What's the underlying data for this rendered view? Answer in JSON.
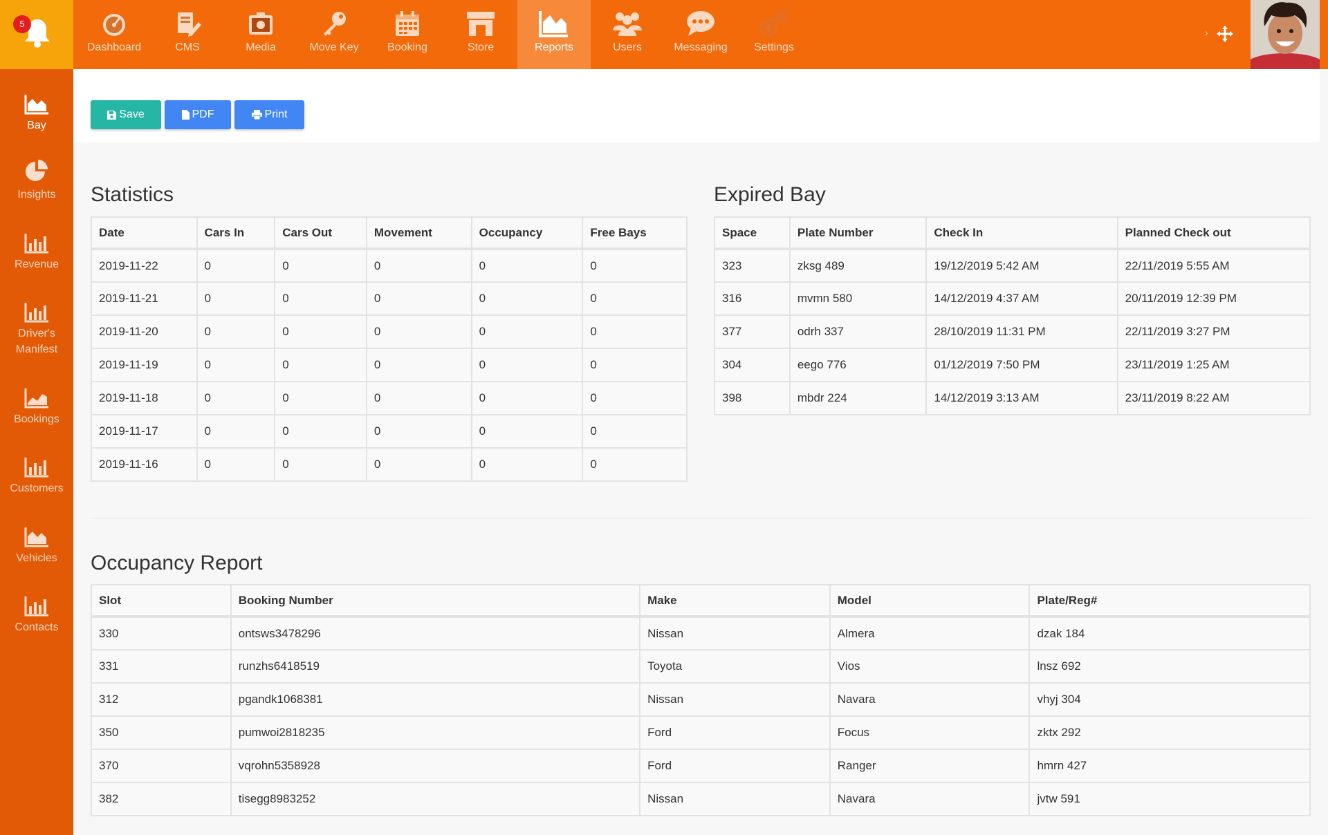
{
  "notifications": {
    "count": "5"
  },
  "topnav": [
    {
      "label": "Dashboard",
      "icon": "dashboard-gauge-icon"
    },
    {
      "label": "CMS",
      "icon": "cms-document-edit-icon"
    },
    {
      "label": "Media",
      "icon": "media-camera-icon"
    },
    {
      "label": "Move Key",
      "icon": "key-icon"
    },
    {
      "label": "Booking",
      "icon": "calendar-icon"
    },
    {
      "label": "Store",
      "icon": "store-icon"
    },
    {
      "label": "Reports",
      "icon": "area-chart-icon",
      "active": true
    },
    {
      "label": "Users",
      "icon": "users-icon"
    },
    {
      "label": "Messaging",
      "icon": "chat-bubble-icon"
    },
    {
      "label": "Settings",
      "icon": "gears-icon"
    }
  ],
  "sidebar": [
    {
      "label": "Bay",
      "icon": "area-chart-icon",
      "active": true
    },
    {
      "label": "Insights",
      "icon": "pie-chart-icon"
    },
    {
      "label": "Revenue",
      "icon": "bar-chart-icon"
    },
    {
      "label": "Driver's Manifest",
      "icon": "bar-chart-icon"
    },
    {
      "label": "Bookings",
      "icon": "line-chart-icon"
    },
    {
      "label": "Customers",
      "icon": "bar-chart-icon"
    },
    {
      "label": "Vehicles",
      "icon": "area-chart-icon"
    },
    {
      "label": "Contacts",
      "icon": "bar-chart-icon"
    }
  ],
  "actions": {
    "save": "Save",
    "pdf": "PDF",
    "print": "Print"
  },
  "colors": {
    "topbar": "#f26a0a",
    "sidebar": "#e25a06",
    "bell_box": "#f7a30a",
    "save": "#26b6a6",
    "pdf_print": "#4286f4"
  },
  "statistics": {
    "title": "Statistics",
    "headers": [
      "Date",
      "Cars In",
      "Cars Out",
      "Movement",
      "Occupancy",
      "Free Bays"
    ],
    "rows": [
      [
        "2019-11-22",
        "0",
        "0",
        "0",
        "0",
        "0"
      ],
      [
        "2019-11-21",
        "0",
        "0",
        "0",
        "0",
        "0"
      ],
      [
        "2019-11-20",
        "0",
        "0",
        "0",
        "0",
        "0"
      ],
      [
        "2019-11-19",
        "0",
        "0",
        "0",
        "0",
        "0"
      ],
      [
        "2019-11-18",
        "0",
        "0",
        "0",
        "0",
        "0"
      ],
      [
        "2019-11-17",
        "0",
        "0",
        "0",
        "0",
        "0"
      ],
      [
        "2019-11-16",
        "0",
        "0",
        "0",
        "0",
        "0"
      ]
    ]
  },
  "expired_bay": {
    "title": "Expired Bay",
    "headers": [
      "Space",
      "Plate Number",
      "Check In",
      "Planned Check out"
    ],
    "rows": [
      [
        "323",
        "zksg 489",
        "19/12/2019 5:42 AM",
        "22/11/2019 5:55 AM"
      ],
      [
        "316",
        "mvmn 580",
        "14/12/2019 4:37 AM",
        "20/11/2019 12:39 PM"
      ],
      [
        "377",
        "odrh 337",
        "28/10/2019 11:31 PM",
        "22/11/2019 3:27 PM"
      ],
      [
        "304",
        "eego 776",
        "01/12/2019 7:50 PM",
        "23/11/2019 1:25 AM"
      ],
      [
        "398",
        "mbdr 224",
        "14/12/2019 3:13 AM",
        "23/11/2019 8:22 AM"
      ]
    ]
  },
  "occupancy": {
    "title": "Occupancy Report",
    "headers": [
      "Slot",
      "Booking Number",
      "Make",
      "Model",
      "Plate/Reg#"
    ],
    "rows": [
      [
        "330",
        "ontsws3478296",
        "Nissan",
        "Almera",
        "dzak 184"
      ],
      [
        "331",
        "runzhs6418519",
        "Toyota",
        "Vios",
        "lnsz 692"
      ],
      [
        "312",
        "pgandk1068381",
        "Nissan",
        "Navara",
        "vhyj 304"
      ],
      [
        "350",
        "pumwoi2818235",
        "Ford",
        "Focus",
        "zktx 292"
      ],
      [
        "370",
        "vqrohn5358928",
        "Ford",
        "Ranger",
        "hmrn 427"
      ],
      [
        "382",
        "tisegg8983252",
        "Nissan",
        "Navara",
        "jvtw 591"
      ]
    ]
  }
}
